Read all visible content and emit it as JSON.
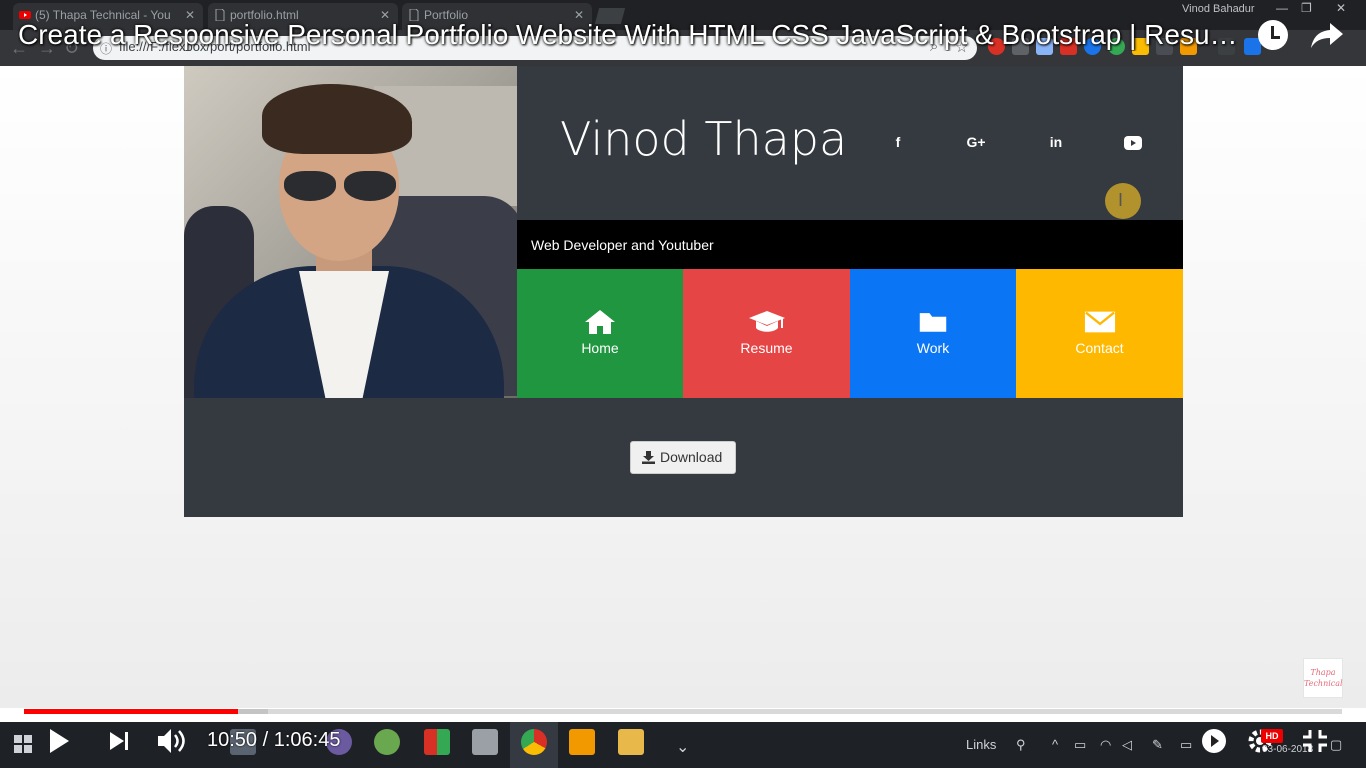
{
  "browser": {
    "tabs": [
      {
        "label": "(5) Thapa Technical - You",
        "favicon": "youtube-icon"
      },
      {
        "label": "portfolio.html",
        "favicon": "document-icon"
      },
      {
        "label": "Portfolio",
        "favicon": "document-icon"
      }
    ],
    "tab_close": "✕",
    "user_name": "Vinod Bahadur",
    "window_controls": [
      "—",
      "❐",
      "✕"
    ],
    "url": "file:///F:/flexbox/port/portfolio.html"
  },
  "video": {
    "title": "Create a Responsive Personal Portfolio Website With HTML CSS JavaScript & Bootstrap | Resume W...",
    "current_time": "10:50",
    "duration": "1:06:45",
    "time_display": "10:50 / 1:06:45",
    "played_fraction": 0.162,
    "buffered_fraction": 0.185,
    "hd_badge": "HD",
    "watermark": "Thapa Technical"
  },
  "portfolio": {
    "name": "Vinod Thapa",
    "tagline": "Web Developer and Youtuber",
    "social": [
      {
        "icon": "facebook-icon",
        "glyph": "f"
      },
      {
        "icon": "google-plus-icon",
        "glyph": "G+"
      },
      {
        "icon": "linkedin-icon",
        "glyph": "in"
      },
      {
        "icon": "youtube-icon",
        "glyph": "▶"
      }
    ],
    "nav": [
      {
        "label": "Home",
        "icon": "home-icon",
        "color": "#219641"
      },
      {
        "label": "Resume",
        "icon": "graduation-cap-icon",
        "color": "#e64545"
      },
      {
        "label": "Work",
        "icon": "folder-icon",
        "color": "#0a76f6"
      },
      {
        "label": "Contact",
        "icon": "envelope-icon",
        "color": "#ffb800"
      }
    ],
    "download_label": "Download"
  },
  "taskbar": {
    "links_label": "Links",
    "date": "03-06-2018"
  }
}
